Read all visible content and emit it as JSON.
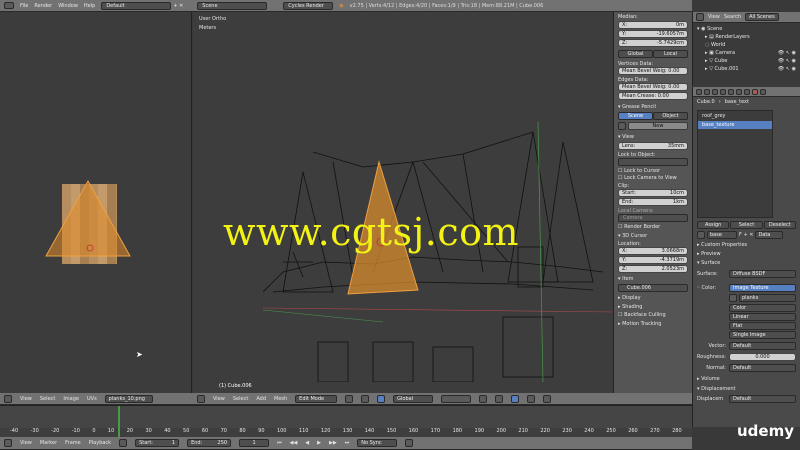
{
  "info_header": {
    "menus": [
      "File",
      "Render",
      "Window",
      "Help"
    ],
    "layout": "Default",
    "scene": "Scene",
    "engine": "Cycles Render",
    "stats": "v2.75 | Verts:4/12 | Edges:4/20 | Faces:1/9 | Tris:18 | Mem:88.21M | Cube.006"
  },
  "viewport": {
    "view_name": "User Ortho",
    "units": "Meters",
    "object_label": "(1) Cube.006",
    "watermark": "www.cgtsj.com"
  },
  "uv_header": {
    "menus": [
      "View",
      "Select",
      "Image",
      "UVs"
    ],
    "image_name": "planks_10.png"
  },
  "view3d_header": {
    "menus": [
      "View",
      "Select",
      "Add",
      "Mesh"
    ],
    "mode": "Edit Mode",
    "orientation": "Global"
  },
  "timeline": {
    "menus": [
      "View",
      "Marker",
      "Frame",
      "Playback"
    ],
    "start_label": "Start:",
    "start_value": "1",
    "end_label": "End:",
    "end_value": "250",
    "current": "1",
    "sync": "No Sync",
    "ticks": [
      "-40",
      "-30",
      "-20",
      "-10",
      "0",
      "10",
      "20",
      "30",
      "40",
      "50",
      "60",
      "70",
      "80",
      "90",
      "100",
      "110",
      "120",
      "130",
      "140",
      "150",
      "160",
      "170",
      "180",
      "190",
      "200",
      "210",
      "220",
      "230",
      "240",
      "250",
      "260",
      "270",
      "280"
    ]
  },
  "n_panel": {
    "median": "Median:",
    "x": {
      "label": "X:",
      "value": "0m"
    },
    "y": {
      "label": "Y:",
      "value": "-19.6057m"
    },
    "z": {
      "label": "Z:",
      "value": "-5.7429cm"
    },
    "global": "Global",
    "local": "Local",
    "vertices_data": "Vertices Data:",
    "mean_bevel_weight": "Mean Bevel Weig: 0.00",
    "edges_data": "Edges Data:",
    "mean_bevel_weight2": "Mean Bevel Weig: 0.00",
    "mean_crease": "Mean Crease:   0.00",
    "grease_pencil": "Grease Pencil",
    "scene_tab": "Scene",
    "object_tab": "Object",
    "new_btn": "New",
    "view_section": "View",
    "lens": {
      "label": "Lens:",
      "value": "35mm"
    },
    "lock_to_object": "Lock to Object:",
    "lock_to_cursor": "Lock to Cursor",
    "lock_camera": "Lock Camera to View",
    "clip": "Clip:",
    "clip_start": {
      "label": "Start:",
      "value": "10cm"
    },
    "clip_end": {
      "label": "End:",
      "value": "1km"
    },
    "local_camera": "Local Camera:",
    "camera_field": "Camera",
    "render_border": "Render Border",
    "cursor_3d": "3D Cursor",
    "location": "Location:",
    "cx": {
      "label": "X:",
      "value": "3.0668m"
    },
    "cy": {
      "label": "Y:",
      "value": "-4.3719m"
    },
    "cz": {
      "label": "Z:",
      "value": "2.0523m"
    },
    "item": "Item",
    "item_name": "Cube.006",
    "display": "Display",
    "shading": "Shading",
    "backface": "Backface Culling",
    "motion_tracking": "Motion Tracking"
  },
  "outliner": {
    "tabs": [
      "View",
      "Search",
      "All Scenes"
    ],
    "items": [
      "Scene",
      "RenderLayers",
      "World",
      "Camera",
      "Cube",
      "Cube.001"
    ]
  },
  "properties": {
    "breadcrumb": [
      "Cube.0",
      "base_text"
    ],
    "materials": [
      "roof_grey",
      "base_texture"
    ],
    "assign": "Assign",
    "select": "Select",
    "deselect": "Deselect",
    "material_name": "base",
    "data_label": "Data",
    "custom_props": "Custom Properties",
    "preview": "Preview",
    "surface": "Surface",
    "surface_label": "Surface:",
    "surface_value": "Diffuse BSDF",
    "color_label": "Color:",
    "color_value": "Image Texture",
    "image_name": "planks",
    "opt_color": "Color",
    "opt_linear": "Linear",
    "opt_flat": "Flat",
    "opt_single": "Single Image",
    "vector_label": "Vector:",
    "vector_value": "Default",
    "roughness_label": "Roughness:",
    "roughness_value": "0.000",
    "normal_label": "Normal:",
    "normal_value": "Default",
    "volume": "Volume",
    "displacement": "Displacement",
    "displace_label": "Displacem",
    "displace_value": "Default"
  },
  "overlay_logo": "udemy"
}
